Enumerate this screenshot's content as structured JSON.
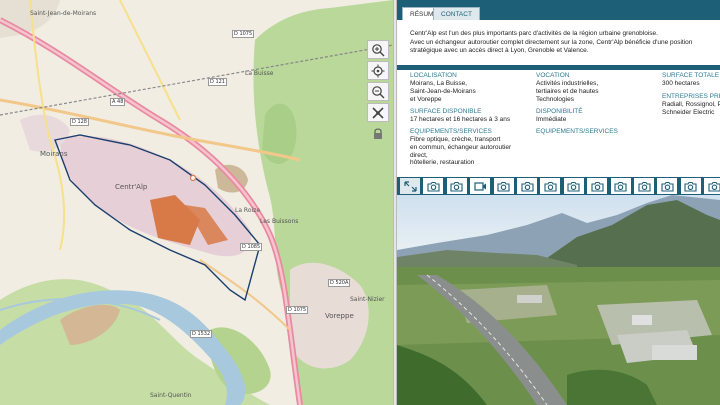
{
  "map": {
    "place_labels": [
      {
        "id": "saint-jean",
        "text": "Saint-Jean-de-Moirans"
      },
      {
        "id": "moirans",
        "text": "Moirans"
      },
      {
        "id": "centr-alp",
        "text": "Centr'Alp"
      },
      {
        "id": "la-buisse",
        "text": "La Buisse"
      },
      {
        "id": "la-roize",
        "text": "La Roize"
      },
      {
        "id": "les-buissons",
        "text": "Les Buissons"
      },
      {
        "id": "voreppe",
        "text": "Voreppe"
      },
      {
        "id": "saint-nizier",
        "text": "Saint-Nizier"
      },
      {
        "id": "saint-quentin",
        "text": "Saint-Quentin"
      }
    ],
    "road_tags": [
      {
        "id": "d1075-top",
        "text": "D 1075"
      },
      {
        "id": "d128",
        "text": "D 128"
      },
      {
        "id": "d121",
        "text": "D 121"
      },
      {
        "id": "a48",
        "text": "A 48"
      },
      {
        "id": "d1085",
        "text": "D 1085"
      },
      {
        "id": "d1532",
        "text": "D 1532"
      },
      {
        "id": "d520a",
        "text": "D 520A"
      },
      {
        "id": "d1075-bottom",
        "text": "D 1075"
      }
    ],
    "controls": {
      "zoom_in": "zoom-in",
      "locate": "locate",
      "zoom_out": "zoom-out",
      "pegman": "street-view",
      "lock": "lock"
    }
  },
  "panel": {
    "tabs": [
      {
        "label": "RÉSUMÉ",
        "active": true
      },
      {
        "label": "CONTACT",
        "active": false
      }
    ],
    "intro": "Centr'Alp est l'un des plus importants parc d'activités de la région urbaine grenobloise.\nAvec un échangeur autoroutier complet directement sur la zone, Centr'Alp bénéficie d'une position\nstratégique avec un accès direct à Lyon, Grenoble et Valence.",
    "facts": {
      "localisation": {
        "label": "LOCALISATION",
        "value": "Moirans, La Buisse,\nSaint-Jean-de-Moirans\net Voreppe"
      },
      "surface_disponible": {
        "label": "SURFACE DISPONIBLE",
        "value": "17 hectares et 16 hectares à 3 ans"
      },
      "equipements_1": {
        "label": "EQUIPEMENTS/SERVICES",
        "value": "Fibre optique, crèche, transport\nen commun, échangeur autoroutier\ndirect,\nhôtellerie, restauration"
      },
      "vocation": {
        "label": "VOCATION",
        "value": "Activités industrielles,\ntertiaires et de hautes\nTechnologies"
      },
      "disponibilite": {
        "label": "DISPONIBILITÉ",
        "value": "Immédiate"
      },
      "equipements_2": {
        "label": "EQUIPEMENTS/SERVICES",
        "value": ""
      },
      "surface_totale": {
        "label": "SURFACE TOTALE",
        "value": "300 hectares"
      },
      "entreprises": {
        "label": "ENTREPRISES PRÉSENTES",
        "value": "Radiall, Rossignol, Po\nSchneider Electric"
      }
    },
    "gallery": {
      "items": [
        "expand",
        "photo",
        "photo",
        "video",
        "photo",
        "photo",
        "photo",
        "photo",
        "photo",
        "photo",
        "photo",
        "photo",
        "photo",
        "photo"
      ]
    }
  },
  "colors": {
    "panel_blue": "#1c5f77",
    "label_blue": "#2c7a94",
    "zone_orange": "#d87a48",
    "motorway_pink": "#e88aa0",
    "river": "#a8c8de",
    "forest": "#b9d89a"
  }
}
